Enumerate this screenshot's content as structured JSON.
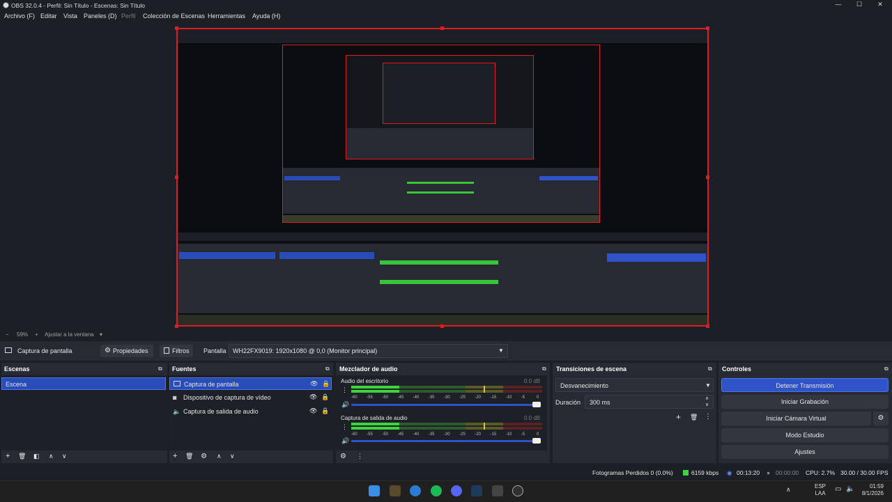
{
  "window": {
    "title": "OBS 32.0.4 - Perfil: Sin Título - Escenas: Sin Título",
    "minimize": "—",
    "maximize": "☐",
    "close": "✕"
  },
  "menu": {
    "items": [
      "Archivo (F)",
      "Editar",
      "Vista",
      "Paneles (D)",
      "Perfil",
      "Colección de Escenas",
      "Herramientas",
      "Ayuda (H)"
    ]
  },
  "zoom": {
    "minus": "−",
    "value": "59%",
    "plus": "+",
    "fit": "Ajustar a la ventana",
    "arrow": "▾"
  },
  "source_bar": {
    "source_name": "Captura de pantalla",
    "properties": "Propiedades",
    "filters": "Filtros",
    "display_label": "Pantalla",
    "display_value": "WH22FX9019: 1920x1080 @ 0,0 (Monitor principal)"
  },
  "scenes": {
    "title": "Escenas",
    "items": [
      "Escena"
    ]
  },
  "sources": {
    "title": "Fuentes",
    "items": [
      "Captura de pantalla",
      "Dispositivo de captura de vídeo",
      "Captura de salida de audio"
    ]
  },
  "mixer": {
    "title": "Mezclador de audio",
    "channels": [
      {
        "name": "Audio del escritorio",
        "db": "0.0 dB",
        "level": 0.25
      },
      {
        "name": "Captura de salida de audio",
        "db": "0.0 dB",
        "level": 0.25
      }
    ],
    "ticks": [
      "-60",
      "-55",
      "-50",
      "-45",
      "-40",
      "-35",
      "-30",
      "-25",
      "-20",
      "-15",
      "-10",
      "-5",
      "0"
    ]
  },
  "transitions": {
    "title": "Transiciones de escena",
    "selected": "Desvanecimiento",
    "duration_label": "Duración",
    "duration_value": "300 ms"
  },
  "controls": {
    "title": "Controles",
    "buttons": [
      "Detener Transmisión",
      "Iniciar Grabación",
      "Iniciar Cámara Virtual",
      "Modo Estudio",
      "Ajustes"
    ]
  },
  "status": {
    "dropped": "Fotogramas Perdidos 0 (0.0%)",
    "bitrate": "6159 kbps",
    "stream_time": "00:13:20",
    "rec_time": "00:00:00",
    "cpu": "CPU: 2.7%",
    "fps": "30.00 / 30.00 FPS"
  },
  "taskbar": {
    "lang_top": "ESP",
    "lang_bottom": "LAA",
    "time": "01:59",
    "date": "8/1/2026"
  },
  "colors": {
    "accent_selected": "#284cb8",
    "primary_button": "#2f53c9",
    "preview_border": "#e01b24"
  }
}
